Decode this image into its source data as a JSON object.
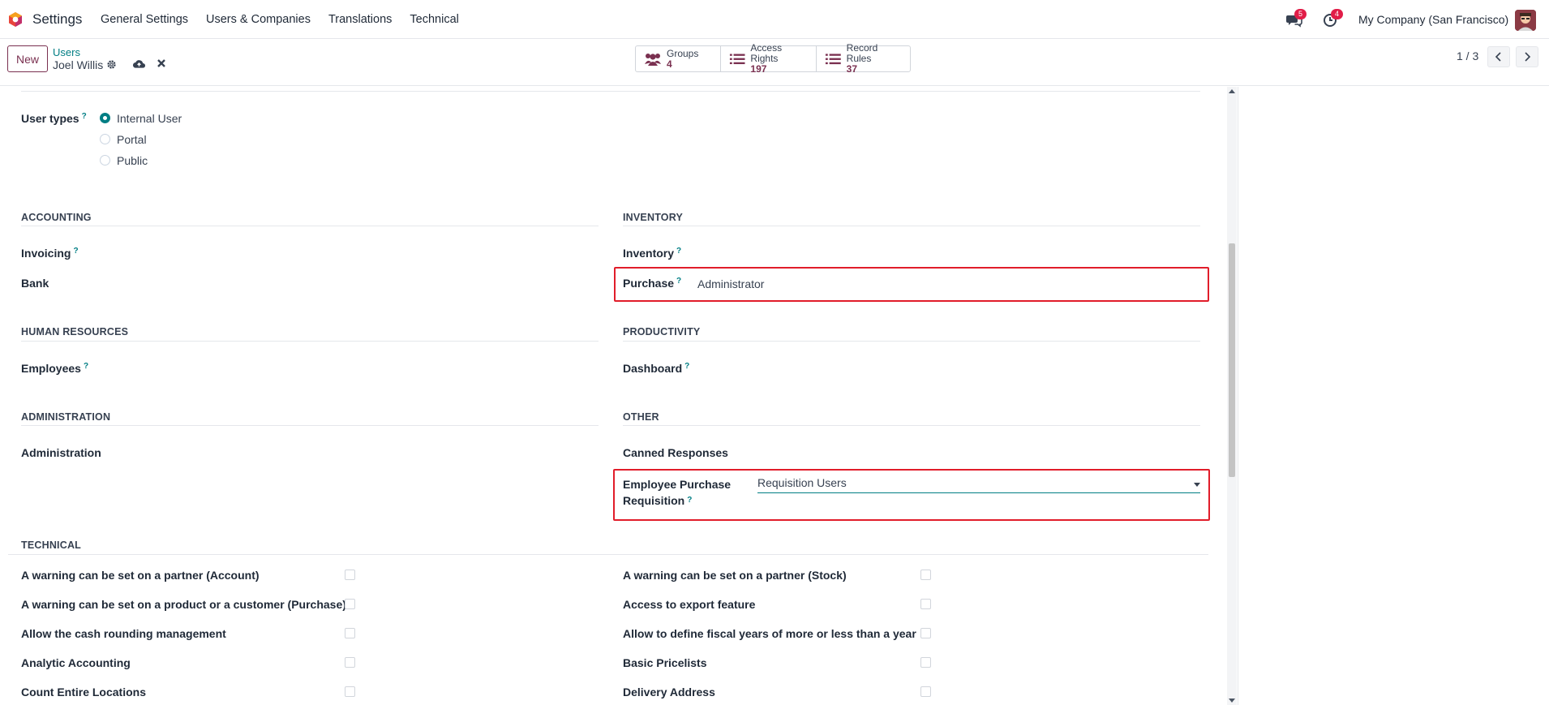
{
  "navbar": {
    "app_name": "Settings",
    "menu": [
      "General Settings",
      "Users & Companies",
      "Translations",
      "Technical"
    ],
    "messages_badge": "5",
    "activities_badge": "4",
    "company": "My Company (San Francisco)"
  },
  "control": {
    "new_label": "New",
    "breadcrumb_parent": "Users",
    "breadcrumb_current": "Joel Willis",
    "stats": [
      {
        "label": "Groups",
        "value": "4",
        "icon": "users-icon"
      },
      {
        "label": "Access Rights",
        "value": "197",
        "icon": "list-icon"
      },
      {
        "label": "Record Rules",
        "value": "37",
        "icon": "list-icon"
      }
    ],
    "pager": "1 / 3"
  },
  "form": {
    "user_types_label": "User types",
    "user_types_help": "?",
    "user_types": [
      {
        "label": "Internal User",
        "selected": true
      },
      {
        "label": "Portal",
        "selected": false
      },
      {
        "label": "Public",
        "selected": false
      }
    ],
    "sections": {
      "accounting": "ACCOUNTING",
      "inventory": "INVENTORY",
      "human_resources": "HUMAN RESOURCES",
      "productivity": "PRODUCTIVITY",
      "administration": "ADMINISTRATION",
      "other": "OTHER",
      "technical": "TECHNICAL"
    },
    "fields": {
      "invoicing": "Invoicing",
      "bank": "Bank",
      "inventory": "Inventory",
      "purchase": "Purchase",
      "purchase_value": "Administrator",
      "employees": "Employees",
      "dashboard": "Dashboard",
      "administration": "Administration",
      "canned_responses": "Canned Responses",
      "epr_line1": "Employee Purchase",
      "epr_line2": "Requisition",
      "epr_value": "Requisition Users",
      "help": "?"
    },
    "technical_left": [
      "A warning can be set on a partner (Account)",
      "A warning can be set on a product or a customer (Purchase)",
      "Allow the cash rounding management",
      "Analytic Accounting",
      "Count Entire Locations"
    ],
    "technical_right": [
      "A warning can be set on a partner (Stock)",
      "Access to export feature",
      "Allow to define fiscal years of more or less than a year",
      "Basic Pricelists",
      "Delivery Address"
    ]
  }
}
